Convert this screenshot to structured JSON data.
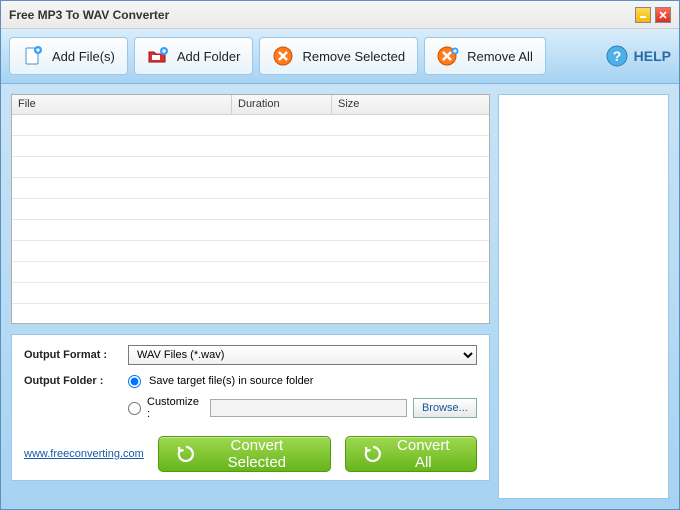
{
  "title": "Free MP3 To WAV Converter",
  "toolbar": {
    "add_files": "Add File(s)",
    "add_folder": "Add Folder",
    "remove_selected": "Remove Selected",
    "remove_all": "Remove All",
    "help": "HELP"
  },
  "table": {
    "col_file": "File",
    "col_duration": "Duration",
    "col_size": "Size",
    "rows": []
  },
  "output": {
    "format_label": "Output Format :",
    "format_value": "WAV Files (*.wav)",
    "folder_label": "Output Folder :",
    "radio_source": "Save target file(s) in source folder",
    "radio_customize": "Customize :",
    "customize_path": "",
    "browse": "Browse..."
  },
  "actions": {
    "convert_selected": "Convert Selected",
    "convert_all": "Convert All"
  },
  "footer": {
    "url": "www.freeconverting.com"
  }
}
